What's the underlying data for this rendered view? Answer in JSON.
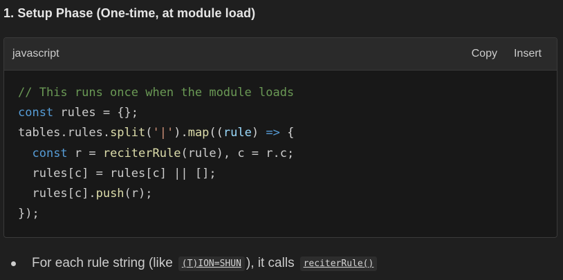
{
  "heading": "1. Setup Phase (One-time, at module load)",
  "code_block": {
    "language": "javascript",
    "copy_label": "Copy",
    "insert_label": "Insert",
    "lines": [
      [
        {
          "t": "// This runs once when the module loads",
          "c": "comment"
        }
      ],
      [
        {
          "t": "const",
          "c": "keyword"
        },
        {
          "t": " rules = {};",
          "c": "var"
        }
      ],
      [
        {
          "t": "tables.rules.",
          "c": "var"
        },
        {
          "t": "split",
          "c": "func"
        },
        {
          "t": "(",
          "c": "punc"
        },
        {
          "t": "'|'",
          "c": "string"
        },
        {
          "t": ").",
          "c": "punc"
        },
        {
          "t": "map",
          "c": "func"
        },
        {
          "t": "((",
          "c": "punc"
        },
        {
          "t": "rule",
          "c": "param"
        },
        {
          "t": ") ",
          "c": "punc"
        },
        {
          "t": "=>",
          "c": "keyword"
        },
        {
          "t": " {",
          "c": "punc"
        }
      ],
      [
        {
          "t": "  ",
          "c": "var"
        },
        {
          "t": "const",
          "c": "keyword"
        },
        {
          "t": " r = ",
          "c": "var"
        },
        {
          "t": "reciterRule",
          "c": "func"
        },
        {
          "t": "(rule), c = r.c;",
          "c": "var"
        }
      ],
      [
        {
          "t": "  rules[c] = rules[c] || [];",
          "c": "var"
        }
      ],
      [
        {
          "t": "  rules[c].",
          "c": "var"
        },
        {
          "t": "push",
          "c": "func"
        },
        {
          "t": "(r);",
          "c": "var"
        }
      ],
      [
        {
          "t": "});",
          "c": "var"
        }
      ]
    ]
  },
  "bullet": {
    "text_before": "For each rule string (like",
    "code1": "(T)ION=SHUN",
    "text_middle": "), it calls",
    "code2": "reciterRule()"
  }
}
